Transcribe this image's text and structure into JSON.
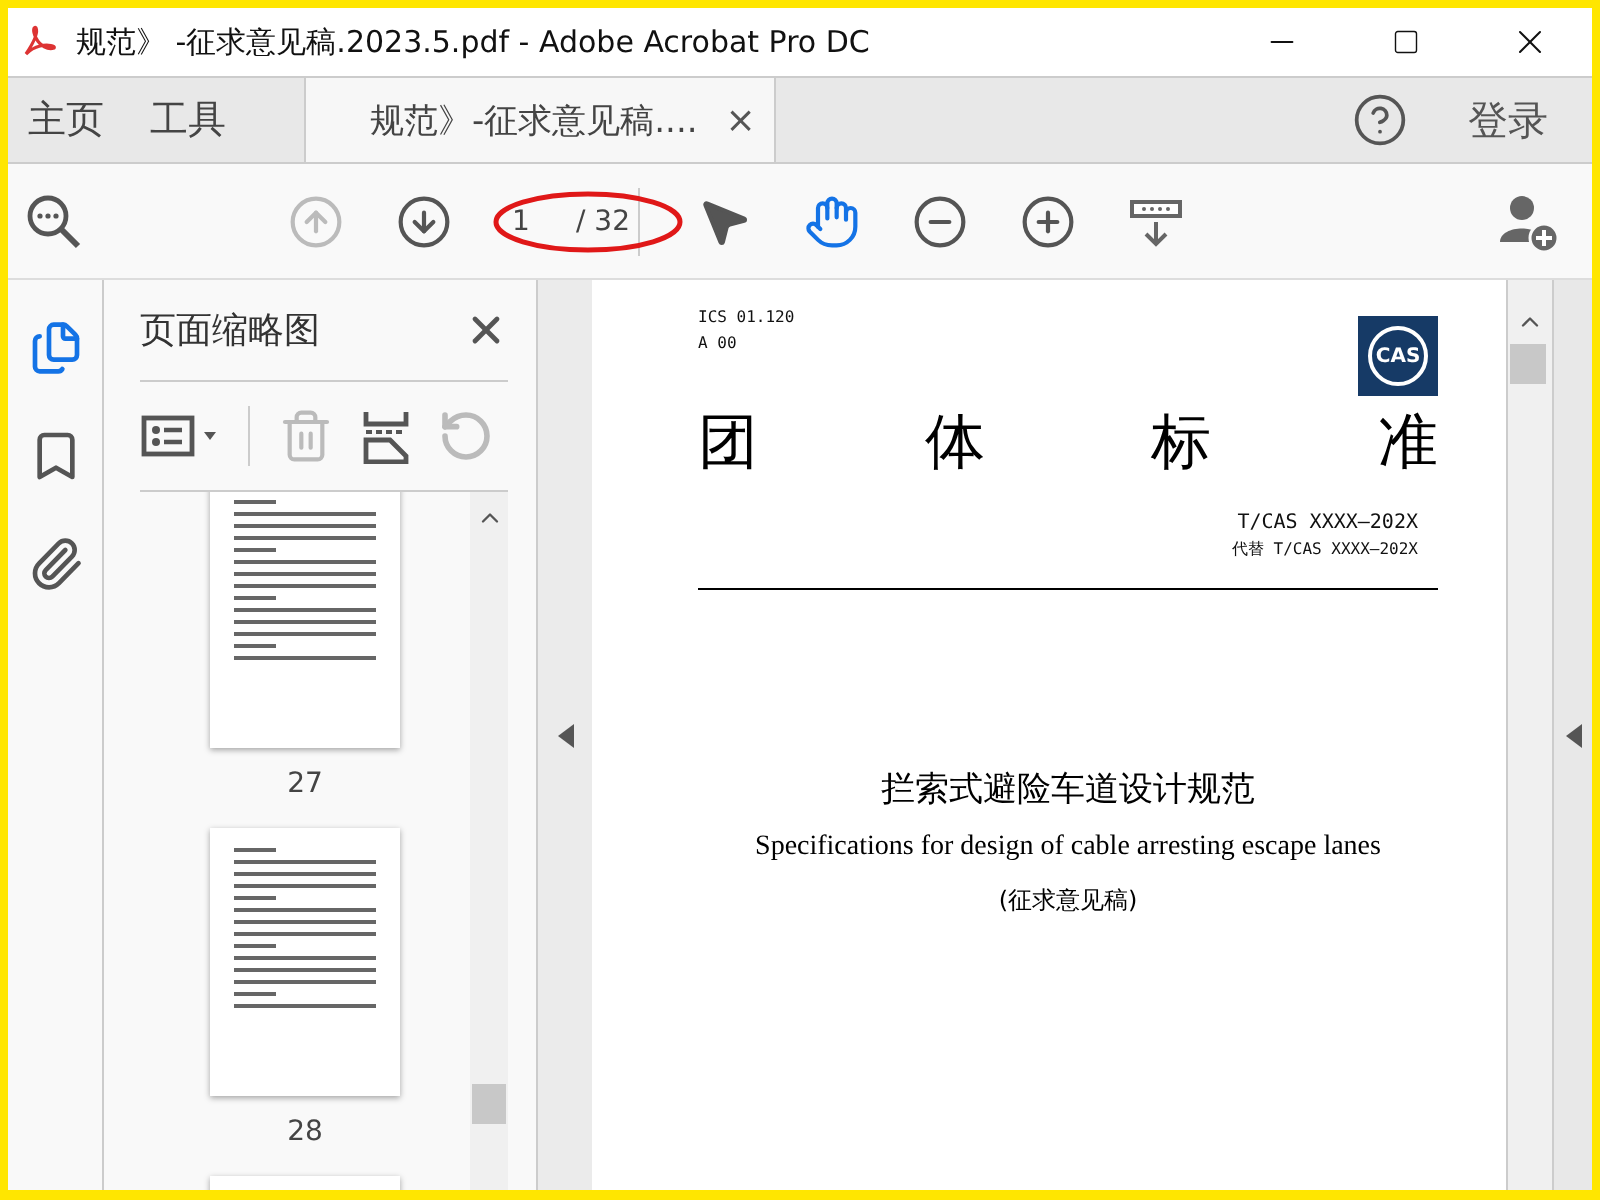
{
  "window": {
    "title": "规范》 -征求意见稿.2023.5.pdf - Adobe Acrobat Pro DC"
  },
  "tabs": [
    {
      "label": "主页",
      "selected": false
    },
    {
      "label": "工具",
      "selected": false
    },
    {
      "label": "规范》-征求意见稿....",
      "selected": true,
      "close": "×"
    }
  ],
  "account": {
    "label": "登录"
  },
  "toolbar": {
    "prev_page": {
      "disabled": true
    },
    "next_page": {
      "disabled": false
    },
    "page_current": "1",
    "page_total": "/ 32",
    "highlighted": true,
    "tools": [
      {
        "kind": "select",
        "selected": false
      },
      {
        "kind": "hand",
        "selected": true
      }
    ]
  },
  "rail": [
    {
      "kind": "pages",
      "selected": true
    },
    {
      "kind": "bookmarks",
      "selected": false
    },
    {
      "kind": "attachments",
      "selected": false
    }
  ],
  "thumbnails_panel": {
    "title": "页面缩略图",
    "delete_disabled": true,
    "rotate_disabled": true,
    "thumbnails": [
      {
        "label": "27"
      },
      {
        "label": "28"
      }
    ]
  },
  "document": {
    "ics": "ICS 01.120",
    "class_code": "A 00",
    "logo": "CAS",
    "heading": "团体标准",
    "standard_no": "T/CAS XXXX—202X",
    "replaces": "代替 T/CAS XXXX—202X",
    "title": "拦索式避险车道设计规范",
    "title_en": "Specifications for design of cable arresting escape lanes",
    "status": "(征求意见稿)"
  }
}
